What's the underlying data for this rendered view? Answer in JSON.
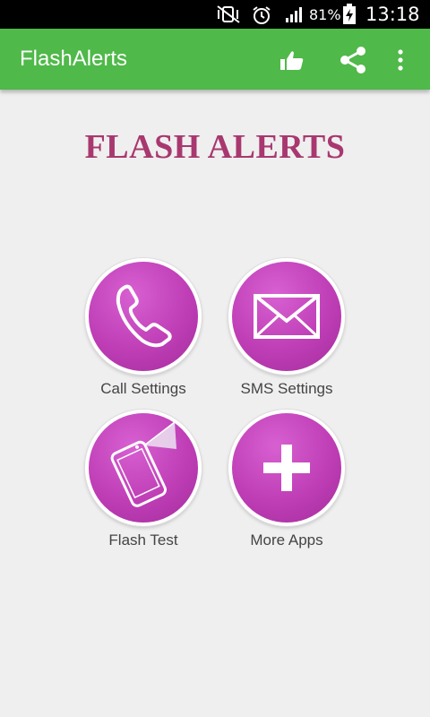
{
  "status_bar": {
    "battery_percent": "81%",
    "time": "13:18",
    "icons": [
      "mute-vibrate-icon",
      "alarm-icon",
      "signal-icon",
      "battery-charging-icon"
    ]
  },
  "app_bar": {
    "title": "FlashAlerts",
    "actions": [
      "thumbs-up-icon",
      "share-icon",
      "overflow-menu-icon"
    ],
    "color": "#4fb949"
  },
  "main": {
    "heading": "FLASH ALERTS",
    "heading_color": "#a8386f",
    "tiles": [
      {
        "label": "Call Settings",
        "icon": "phone-icon"
      },
      {
        "label": "SMS Settings",
        "icon": "envelope-icon"
      },
      {
        "label": "Flash Test",
        "icon": "phone-flash-icon"
      },
      {
        "label": "More Apps",
        "icon": "plus-icon"
      }
    ],
    "accent": "#bf3eb6"
  }
}
